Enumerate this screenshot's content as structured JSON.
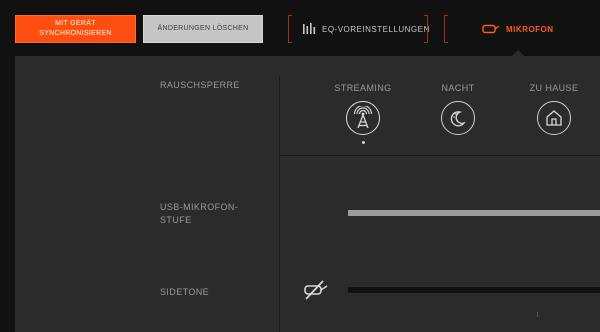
{
  "toolbar": {
    "sync_label": "MIT GERÄT\nSYNCHRONISIEREN",
    "clear_label": "ÄNDERUNGEN LÖSCHEN"
  },
  "tabs": {
    "eq_label": "EQ-VOREINSTELLUNGEN",
    "mic_label": "MIKROFON",
    "active": "mic"
  },
  "noise_gate": {
    "label": "RAUSCHSPERRE",
    "presets": [
      {
        "label": "STREAMING",
        "icon": "broadcast-tower-icon",
        "selected": true
      },
      {
        "label": "NACHT",
        "icon": "moon-stars-icon",
        "selected": false
      },
      {
        "label": "ZU HAUSE",
        "icon": "house-icon",
        "selected": false
      }
    ]
  },
  "usb_mic_level": {
    "label": "USB-MIKROFON-\nSTUFE",
    "value_fraction": 1.0
  },
  "sidetone": {
    "label": "SIDETONE",
    "muted": true,
    "value_fraction": 0.0
  },
  "colors": {
    "accent": "#ff5a1f",
    "sync_button": "#ff4f10",
    "panel": "#2b2b2b",
    "background": "#111111"
  }
}
